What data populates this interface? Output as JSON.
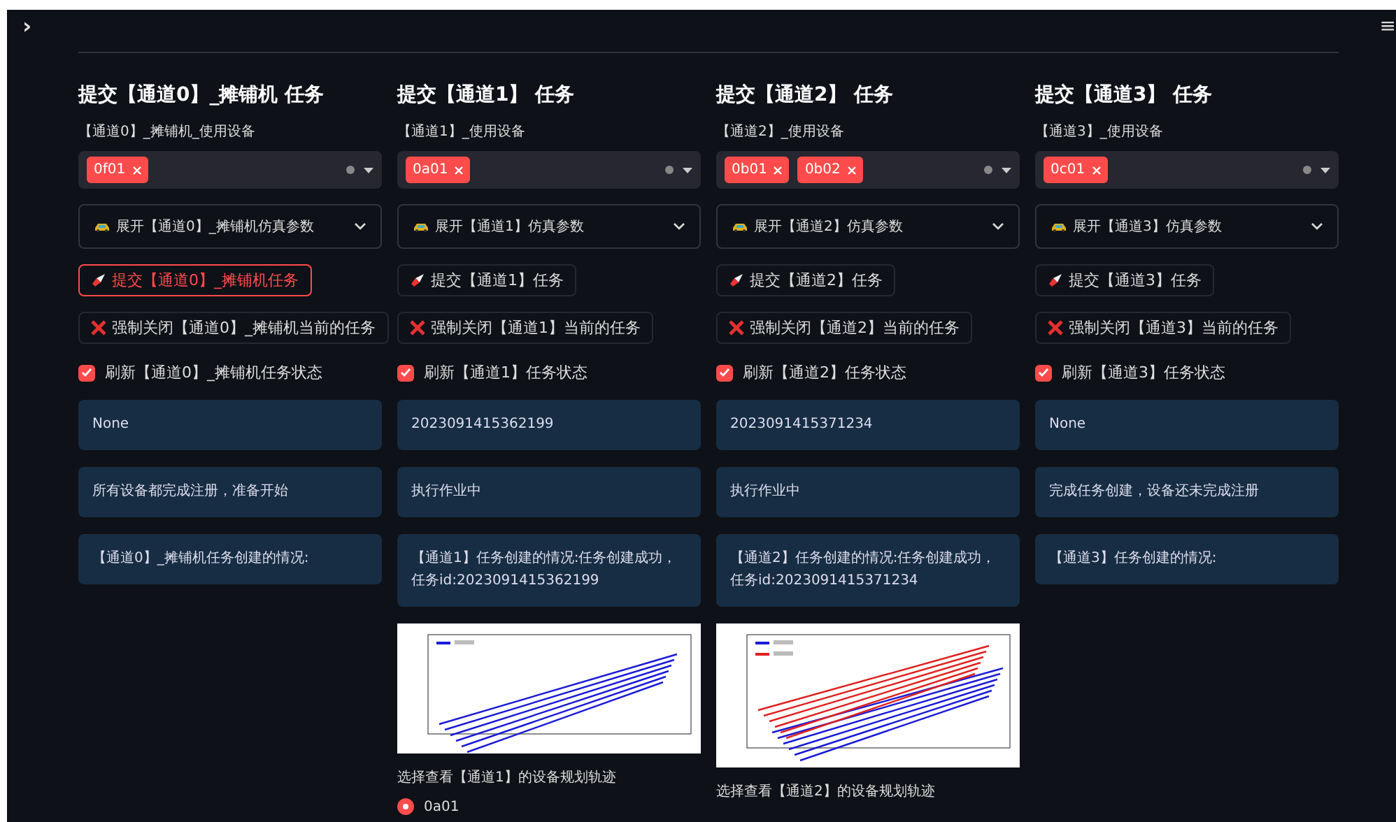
{
  "sidebar_toggle": "›",
  "menu_icon": "≡",
  "columns": [
    {
      "title": "提交【通道0】_摊铺机 任务",
      "device_label": "【通道0】_摊铺机_使用设备",
      "devices": [
        "0f01"
      ],
      "expander": "展开【通道0】_摊铺机仿真参数",
      "submit": {
        "label": "提交【通道0】_摊铺机任务",
        "focused": true
      },
      "close": "强制关闭【通道0】_摊铺机当前的任务",
      "refresh": {
        "label": "刷新【通道0】_摊铺机任务状态",
        "checked": true
      },
      "info": [
        "None",
        "所有设备都完成注册，准备开始",
        "【通道0】_摊铺机任务创建的情况:"
      ]
    },
    {
      "title": "提交【通道1】 任务",
      "device_label": "【通道1】_使用设备",
      "devices": [
        "0a01"
      ],
      "expander": "展开【通道1】仿真参数",
      "submit": {
        "label": "提交【通道1】任务",
        "focused": false
      },
      "close": "强制关闭【通道1】当前的任务",
      "refresh": {
        "label": "刷新【通道1】任务状态",
        "checked": true
      },
      "info": [
        "2023091415362199",
        "执行作业中",
        "【通道1】任务创建的情况:任务创建成功，任务id:2023091415362199"
      ],
      "plot": {
        "series": [
          {
            "color": "#1a1ad8"
          }
        ]
      },
      "caption": "选择查看【通道1】的设备规划轨迹",
      "options": [
        {
          "label": "0a01",
          "selected": true
        }
      ]
    },
    {
      "title": "提交【通道2】 任务",
      "device_label": "【通道2】_使用设备",
      "devices": [
        "0b01",
        "0b02"
      ],
      "expander": "展开【通道2】仿真参数",
      "submit": {
        "label": "提交【通道2】任务",
        "focused": false
      },
      "close": "强制关闭【通道2】当前的任务",
      "refresh": {
        "label": "刷新【通道2】任务状态",
        "checked": true
      },
      "info": [
        "2023091415371234",
        "执行作业中",
        "【通道2】任务创建的情况:任务创建成功，任务id:2023091415371234"
      ],
      "plot": {
        "series": [
          {
            "color": "#1a1ad8"
          },
          {
            "color": "#e02020"
          }
        ]
      },
      "caption": "选择查看【通道2】的设备规划轨迹"
    },
    {
      "title": "提交【通道3】 任务",
      "device_label": "【通道3】_使用设备",
      "devices": [
        "0c01"
      ],
      "expander": "展开【通道3】仿真参数",
      "submit": {
        "label": "提交【通道3】任务",
        "focused": false
      },
      "close": "强制关闭【通道3】当前的任务",
      "refresh": {
        "label": "刷新【通道3】任务状态",
        "checked": true
      },
      "info": [
        "None",
        "完成任务创建，设备还未完成注册",
        "【通道3】任务创建的情况:"
      ]
    }
  ]
}
